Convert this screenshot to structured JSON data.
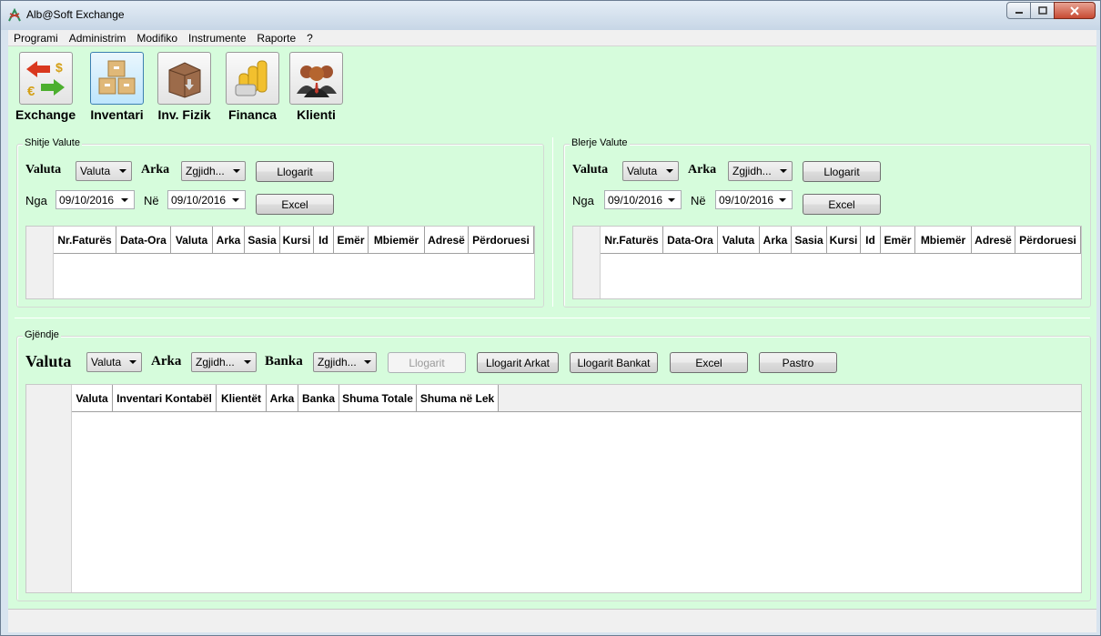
{
  "window": {
    "title": "Alb@Soft Exchange"
  },
  "menu": [
    "Programi",
    "Administrim",
    "Modifiko",
    "Instrumente",
    "Raporte",
    "?"
  ],
  "toolbar": [
    {
      "label": "Exchange",
      "icon": "exchange-icon"
    },
    {
      "label": "Inventari",
      "icon": "boxes-icon",
      "active": true
    },
    {
      "label": "Inv. Fizik",
      "icon": "box-down-icon"
    },
    {
      "label": "Financa",
      "icon": "coins-icon"
    },
    {
      "label": "Klienti",
      "icon": "users-icon"
    }
  ],
  "sell": {
    "title": "Shitje Valute",
    "valuta_label": "Valuta",
    "valuta_value": "Valuta",
    "arka_label": "Arka",
    "arka_value": "Zgjidh...",
    "calc_label": "Llogarit",
    "from_label": "Nga",
    "from_value": "09/10/2016",
    "to_label": "Në",
    "to_value": "09/10/2016",
    "excel_label": "Excel",
    "columns": [
      "Nr.Faturës",
      "Data-Ora",
      "Valuta",
      "Arka",
      "Sasia",
      "Kursi",
      "Id",
      "Emër",
      "Mbiemër",
      "Adresë",
      "Përdoruesi"
    ]
  },
  "buy": {
    "title": "Blerje Valute",
    "valuta_label": "Valuta",
    "valuta_value": "Valuta",
    "arka_label": "Arka",
    "arka_value": "Zgjidh...",
    "calc_label": "Llogarit",
    "from_label": "Nga",
    "from_value": "09/10/2016",
    "to_label": "Në",
    "to_value": "09/10/2016",
    "excel_label": "Excel",
    "columns": [
      "Nr.Faturës",
      "Data-Ora",
      "Valuta",
      "Arka",
      "Sasia",
      "Kursi",
      "Id",
      "Emër",
      "Mbiemër",
      "Adresë",
      "Përdoruesi"
    ]
  },
  "stock": {
    "title": "Gjëndje",
    "valuta_label": "Valuta",
    "valuta_value": "Valuta",
    "arka_label": "Arka",
    "arka_value": "Zgjidh...",
    "banka_label": "Banka",
    "banka_value": "Zgjidh...",
    "calc_label": "Llogarit",
    "calc_arkat_label": "Llogarit Arkat",
    "calc_bankat_label": "Llogarit Bankat",
    "excel_label": "Excel",
    "clear_label": "Pastro",
    "columns": [
      "Valuta",
      "Inventari Kontabël",
      "Klientët",
      "Arka",
      "Banka",
      "Shuma Totale",
      "Shuma në Lek"
    ]
  },
  "colors": {
    "panel": "#d6fcdc",
    "active_tool": "#bee6fd"
  }
}
